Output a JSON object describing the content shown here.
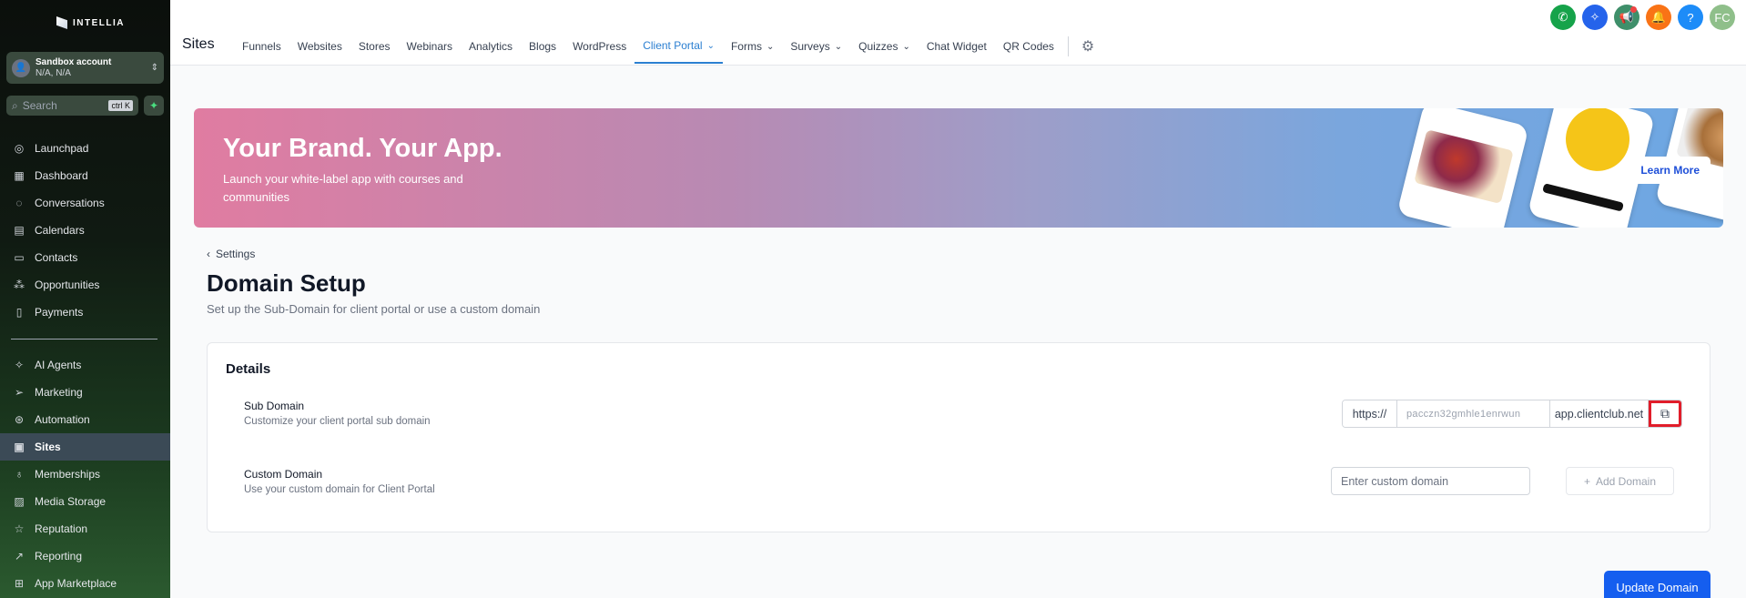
{
  "brand": {
    "name": "INTELLIA"
  },
  "account": {
    "name": "Sandbox account",
    "location": "N/A, N/A"
  },
  "search": {
    "placeholder": "Search",
    "shortcut": "ctrl K"
  },
  "sidebar": {
    "items_top": [
      {
        "label": "Launchpad",
        "icon": "rocket-icon"
      },
      {
        "label": "Dashboard",
        "icon": "grid-icon"
      },
      {
        "label": "Conversations",
        "icon": "chat-icon"
      },
      {
        "label": "Calendars",
        "icon": "calendar-icon"
      },
      {
        "label": "Contacts",
        "icon": "contacts-icon"
      },
      {
        "label": "Opportunities",
        "icon": "pipeline-icon"
      },
      {
        "label": "Payments",
        "icon": "payments-icon"
      }
    ],
    "items_bottom": [
      {
        "label": "AI Agents",
        "icon": "sparkle-icon"
      },
      {
        "label": "Marketing",
        "icon": "send-icon"
      },
      {
        "label": "Automation",
        "icon": "automation-icon"
      },
      {
        "label": "Sites",
        "icon": "sites-icon",
        "active": true
      },
      {
        "label": "Memberships",
        "icon": "award-icon"
      },
      {
        "label": "Media Storage",
        "icon": "image-icon"
      },
      {
        "label": "Reputation",
        "icon": "star-icon"
      },
      {
        "label": "Reporting",
        "icon": "trend-icon"
      },
      {
        "label": "App Marketplace",
        "icon": "apps-icon"
      }
    ]
  },
  "header": {
    "title": "Sites",
    "tabs": [
      {
        "label": "Funnels"
      },
      {
        "label": "Websites"
      },
      {
        "label": "Stores"
      },
      {
        "label": "Webinars"
      },
      {
        "label": "Analytics"
      },
      {
        "label": "Blogs"
      },
      {
        "label": "WordPress"
      },
      {
        "label": "Client Portal",
        "active": true,
        "dropdown": true
      },
      {
        "label": "Forms",
        "dropdown": true
      },
      {
        "label": "Surveys",
        "dropdown": true
      },
      {
        "label": "Quizzes",
        "dropdown": true
      },
      {
        "label": "Chat Widget"
      },
      {
        "label": "QR Codes"
      }
    ],
    "user_initials": "FC"
  },
  "banner": {
    "title": "Your Brand. Your App.",
    "subtitle": "Launch your white-label app with courses and communities",
    "cta": "Learn More"
  },
  "breadcrumb": {
    "back_label": "Settings"
  },
  "page": {
    "title": "Domain Setup",
    "subtitle": "Set up the Sub-Domain for client portal or use a custom domain"
  },
  "details": {
    "heading": "Details",
    "sub_domain": {
      "label": "Sub Domain",
      "description": "Customize your client portal sub domain",
      "prefix": "https://",
      "value": "pacczn32gmhle1enrwun",
      "suffix": "app.clientclub.net"
    },
    "custom_domain": {
      "label": "Custom Domain",
      "description": "Use your custom domain for Client Portal",
      "placeholder": "Enter custom domain",
      "add_label": "Add Domain"
    }
  },
  "footer": {
    "update_label": "Update Domain"
  },
  "colors": {
    "accent": "#155eef",
    "tab_active": "#2b7fd1",
    "highlight": "#e11d2a"
  }
}
